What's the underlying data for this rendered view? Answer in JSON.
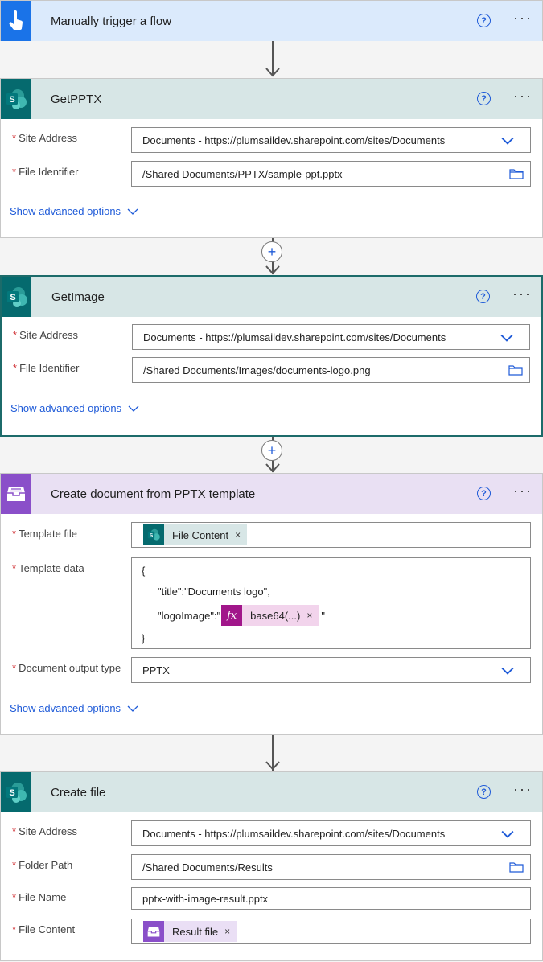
{
  "trigger": {
    "title": "Manually trigger a flow"
  },
  "get_pptx": {
    "title": "GetPPTX",
    "site_label": "Site Address",
    "site_value": "Documents - https://plumsaildev.sharepoint.com/sites/Documents",
    "file_label": "File Identifier",
    "file_value": "/Shared Documents/PPTX/sample-ppt.pptx",
    "advanced": "Show advanced options"
  },
  "get_image": {
    "title": "GetImage",
    "site_label": "Site Address",
    "site_value": "Documents - https://plumsaildev.sharepoint.com/sites/Documents",
    "file_label": "File Identifier",
    "file_value": "/Shared Documents/Images/documents-logo.png",
    "advanced": "Show advanced options"
  },
  "create_doc": {
    "title": "Create document from PPTX template",
    "template_file_label": "Template file",
    "template_file_token": "File Content",
    "template_data_label": "Template data",
    "json_open": "{",
    "json_title_line": "\"title\":\"Documents logo\",",
    "json_logo_key": "\"logoImage\":\"",
    "json_logo_token": "base64(...)",
    "json_logo_end": "\"",
    "json_close": "}",
    "output_type_label": "Document output type",
    "output_type_value": "PPTX",
    "advanced": "Show advanced options"
  },
  "create_file": {
    "title": "Create file",
    "site_label": "Site Address",
    "site_value": "Documents - https://plumsaildev.sharepoint.com/sites/Documents",
    "folder_label": "Folder Path",
    "folder_value": "/Shared Documents/Results",
    "name_label": "File Name",
    "name_value": "pptx-with-image-result.pptx",
    "content_label": "File Content",
    "content_token": "Result file"
  },
  "common": {
    "help": "?",
    "more": "···",
    "required": "*",
    "remove": "×",
    "plus": "+"
  }
}
